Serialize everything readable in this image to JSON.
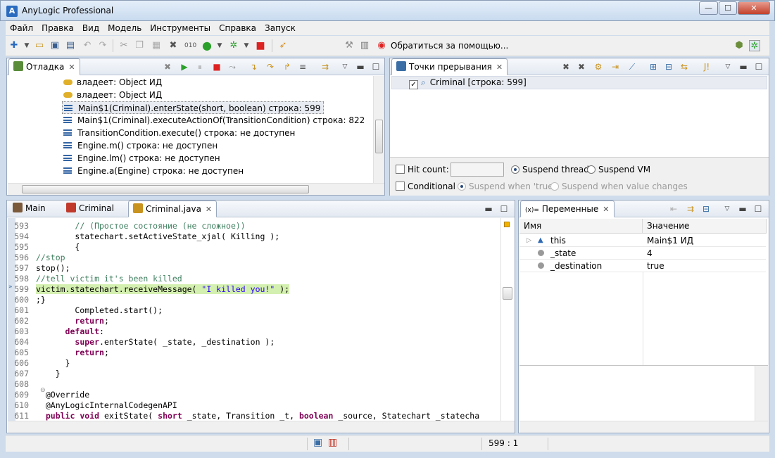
{
  "window": {
    "title": "AnyLogic Professional",
    "minimize": "—",
    "maximize": "☐",
    "close": "✕"
  },
  "menu": [
    "Файл",
    "Правка",
    "Вид",
    "Модель",
    "Инструменты",
    "Справка",
    "Запуск"
  ],
  "toolbar": {
    "help_label": "Обратиться за помощью..."
  },
  "debug_panel": {
    "tab_label": "Отладка",
    "rows": [
      {
        "icon": "key-icon",
        "text": "владеет: Object  ИД"
      },
      {
        "icon": "key-icon",
        "text": "владеет: Object  ИД"
      },
      {
        "icon": "stack-frame-icon",
        "text": "Main$1(Criminal).enterState(short, boolean) строка: 599"
      },
      {
        "icon": "stack-frame-icon",
        "text": "Main$1(Criminal).executeActionOf(TransitionCondition) строка: 822"
      },
      {
        "icon": "stack-frame-icon",
        "text": "TransitionCondition.execute() строка: не доступен"
      },
      {
        "icon": "stack-frame-icon",
        "text": "Engine.m() строка: не доступен"
      },
      {
        "icon": "stack-frame-icon",
        "text": "Engine.lm() строка: не доступен"
      },
      {
        "icon": "stack-frame-icon",
        "text": "Engine.a(Engine) строка: не доступен"
      }
    ]
  },
  "breakpoints_panel": {
    "tab_label": "Точки прерывания",
    "items": [
      {
        "checked": true,
        "label": "Criminal [строка: 599]"
      }
    ],
    "hit_count_label": "Hit count:",
    "hit_count_value": "",
    "suspend_thread_label": "Suspend thread",
    "suspend_vm_label": "Suspend VM",
    "conditional_label": "Conditional",
    "suspend_true_label": "Suspend when 'true'",
    "suspend_change_label": "Suspend when value changes"
  },
  "editor": {
    "tabs": [
      "Main",
      "Criminal",
      "Criminal.java"
    ],
    "lines": [
      {
        "n": "593",
        "segs": [
          [
            "        ",
            ""
          ],
          [
            "// (Простое состояние (не сложное))",
            "cm"
          ]
        ]
      },
      {
        "n": "594",
        "segs": [
          [
            "        statechart.setActiveState_xjal( Killing );",
            ""
          ]
        ]
      },
      {
        "n": "595",
        "segs": [
          [
            "        {",
            ""
          ]
        ]
      },
      {
        "n": "596",
        "segs": [
          [
            "//stop",
            "cm"
          ]
        ]
      },
      {
        "n": "597",
        "segs": [
          [
            "stop();",
            ""
          ]
        ]
      },
      {
        "n": "598",
        "segs": [
          [
            "//tell victim it's been killed",
            "cm"
          ]
        ]
      },
      {
        "n": "599",
        "segs": [
          [
            "victim.statechart.receiveMessage( ",
            ""
          ],
          [
            "\"I killed you!\"",
            "st"
          ],
          [
            " );",
            ""
          ]
        ],
        "current": true
      },
      {
        "n": "600",
        "segs": [
          [
            ";}",
            ""
          ]
        ]
      },
      {
        "n": "601",
        "segs": [
          [
            "        Completed.start();",
            ""
          ]
        ]
      },
      {
        "n": "602",
        "segs": [
          [
            "        ",
            ""
          ],
          [
            "return",
            "kw"
          ],
          [
            ";",
            ""
          ]
        ]
      },
      {
        "n": "603",
        "segs": [
          [
            "      ",
            ""
          ],
          [
            "default",
            "kw"
          ],
          [
            ":",
            ""
          ]
        ]
      },
      {
        "n": "604",
        "segs": [
          [
            "        ",
            ""
          ],
          [
            "super",
            "kw"
          ],
          [
            ".enterState( _state, _destination );",
            ""
          ]
        ]
      },
      {
        "n": "605",
        "segs": [
          [
            "        ",
            ""
          ],
          [
            "return",
            "kw"
          ],
          [
            ";",
            ""
          ]
        ]
      },
      {
        "n": "606",
        "segs": [
          [
            "      }",
            ""
          ]
        ]
      },
      {
        "n": "607",
        "segs": [
          [
            "    }",
            ""
          ]
        ]
      },
      {
        "n": "608",
        "segs": [
          [
            "",
            ""
          ]
        ]
      },
      {
        "n": "609",
        "segs": [
          [
            "  @Override",
            ""
          ]
        ]
      },
      {
        "n": "610",
        "segs": [
          [
            "  @AnyLogicInternalCodegenAPI",
            ""
          ]
        ]
      },
      {
        "n": "611",
        "segs": [
          [
            "  ",
            ""
          ],
          [
            "public",
            "kw"
          ],
          [
            " ",
            ""
          ],
          [
            "void",
            "kw"
          ],
          [
            " exitState( ",
            ""
          ],
          [
            "short",
            "kw"
          ],
          [
            " _state, Transition _t, ",
            ""
          ],
          [
            "boolean",
            "kw"
          ],
          [
            " _source, Statechart _statecha",
            ""
          ]
        ]
      }
    ]
  },
  "variables_panel": {
    "tab_label": "Переменные",
    "col_name": "Имя",
    "col_value": "Значение",
    "rows": [
      {
        "name": "this",
        "value": "Main$1  ИД",
        "icon": "field-triangle-icon"
      },
      {
        "name": "_state",
        "value": "4",
        "icon": "local-var-icon"
      },
      {
        "name": "_destination",
        "value": "true",
        "icon": "local-var-icon"
      }
    ]
  },
  "status": {
    "position": "599 : 1"
  }
}
